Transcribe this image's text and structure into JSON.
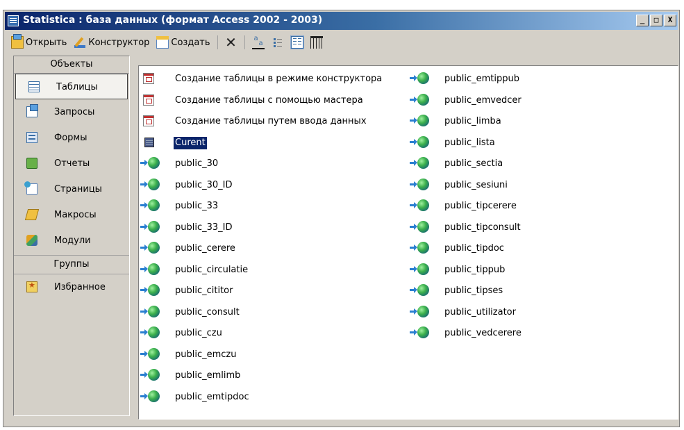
{
  "window": {
    "title": "Statistica : база данных (формат Access 2002 - 2003)",
    "controls": [
      "_",
      "□",
      "X"
    ]
  },
  "toolbar": {
    "open_label": "Открыть",
    "design_label": "Конструктор",
    "new_label": "Создать"
  },
  "sidebar": {
    "objects_header": "Объекты",
    "items": [
      {
        "label": "Таблицы",
        "icon": "table-icon"
      },
      {
        "label": "Запросы",
        "icon": "query-icon"
      },
      {
        "label": "Формы",
        "icon": "form-icon"
      },
      {
        "label": "Отчеты",
        "icon": "report-icon"
      },
      {
        "label": "Страницы",
        "icon": "page-icon"
      },
      {
        "label": "Макросы",
        "icon": "macro-icon"
      },
      {
        "label": "Модули",
        "icon": "module-icon"
      }
    ],
    "groups_header": "Группы",
    "groups": [
      {
        "label": "Избранное",
        "icon": "favorites-icon"
      }
    ]
  },
  "list": {
    "col1": [
      {
        "label": "Создание таблицы в режиме конструктора",
        "icon": "wizard-icon"
      },
      {
        "label": "Создание таблицы с помощью мастера",
        "icon": "wizard-icon"
      },
      {
        "label": "Создание таблицы путем ввода данных",
        "icon": "wizard-icon"
      },
      {
        "label": "Curent",
        "icon": "table-icon",
        "selected": true
      },
      {
        "label": "public_30",
        "icon": "linked-table-icon"
      },
      {
        "label": "public_30_ID",
        "icon": "linked-table-icon"
      },
      {
        "label": "public_33",
        "icon": "linked-table-icon"
      },
      {
        "label": "public_33_ID",
        "icon": "linked-table-icon"
      },
      {
        "label": "public_cerere",
        "icon": "linked-table-icon"
      },
      {
        "label": "public_circulatie",
        "icon": "linked-table-icon"
      },
      {
        "label": "public_cititor",
        "icon": "linked-table-icon"
      },
      {
        "label": "public_consult",
        "icon": "linked-table-icon"
      },
      {
        "label": "public_czu",
        "icon": "linked-table-icon"
      },
      {
        "label": "public_emczu",
        "icon": "linked-table-icon"
      },
      {
        "label": "public_emlimb",
        "icon": "linked-table-icon"
      },
      {
        "label": "public_emtipdoc",
        "icon": "linked-table-icon"
      }
    ],
    "col2": [
      {
        "label": "public_emtippub",
        "icon": "linked-table-icon"
      },
      {
        "label": "public_emvedcer",
        "icon": "linked-table-icon"
      },
      {
        "label": "public_limba",
        "icon": "linked-table-icon"
      },
      {
        "label": "public_lista",
        "icon": "linked-table-icon"
      },
      {
        "label": "public_sectia",
        "icon": "linked-table-icon"
      },
      {
        "label": "public_sesiuni",
        "icon": "linked-table-icon"
      },
      {
        "label": "public_tipcerere",
        "icon": "linked-table-icon"
      },
      {
        "label": "public_tipconsult",
        "icon": "linked-table-icon"
      },
      {
        "label": "public_tipdoc",
        "icon": "linked-table-icon"
      },
      {
        "label": "public_tippub",
        "icon": "linked-table-icon"
      },
      {
        "label": "public_tipses",
        "icon": "linked-table-icon"
      },
      {
        "label": "public_utilizator",
        "icon": "linked-table-icon"
      },
      {
        "label": "public_vedcerere",
        "icon": "linked-table-icon"
      }
    ]
  },
  "colors": {
    "titlebar_start": "#0a246a",
    "titlebar_end": "#a6caf0",
    "window_face": "#d4d0c8",
    "selection": "#0a246a"
  }
}
